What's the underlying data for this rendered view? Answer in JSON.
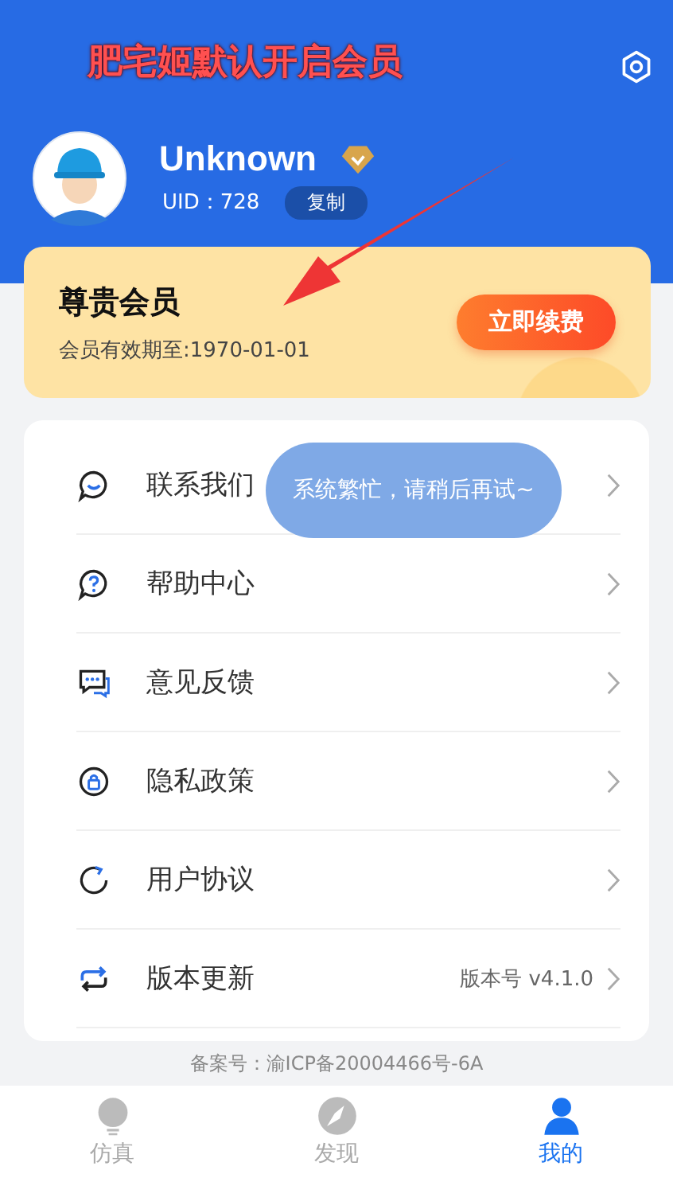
{
  "annotation": {
    "text": "肥宅姬默认开启会员"
  },
  "profile": {
    "name": "Unknown",
    "uid": "UID：728",
    "copy_button": "复制"
  },
  "membership": {
    "title": "尊贵会员",
    "expiry": "会员有效期至:1970-01-01",
    "renew_button": "立即续费"
  },
  "menu": [
    {
      "kind": "contact",
      "label": "联系我们"
    },
    {
      "kind": "help",
      "label": "帮助中心"
    },
    {
      "kind": "feedback",
      "label": "意见反馈"
    },
    {
      "kind": "privacy",
      "label": "隐私政策"
    },
    {
      "kind": "agreement",
      "label": "用户协议"
    },
    {
      "kind": "update",
      "label": "版本更新",
      "value": "版本号 v4.1.0"
    }
  ],
  "toast": "系统繁忙，请稍后再试~",
  "footer": "备案号：渝ICP备20004466号-6A",
  "tabs": [
    {
      "kind": "bulb",
      "label": "仿真",
      "selected": false
    },
    {
      "kind": "compass",
      "label": "发现",
      "selected": false
    },
    {
      "kind": "person",
      "label": "我的",
      "selected": true
    }
  ]
}
